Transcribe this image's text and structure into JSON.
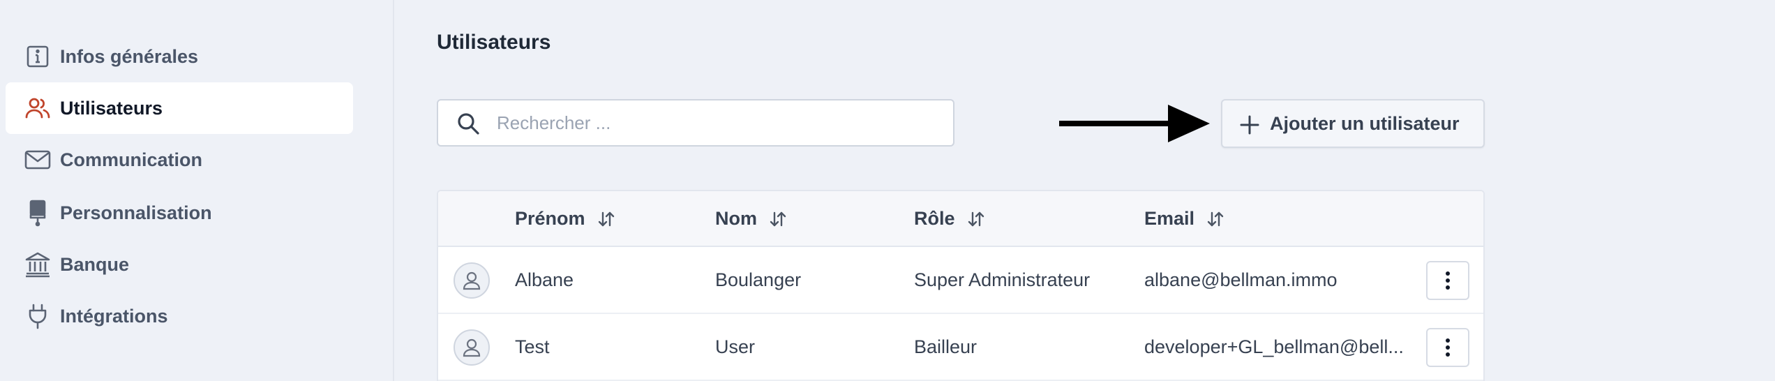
{
  "sidebar": {
    "items": [
      {
        "label": "Infos générales",
        "icon": "info-icon",
        "active": false
      },
      {
        "label": "Utilisateurs",
        "icon": "users-icon",
        "active": true
      },
      {
        "label": "Communication",
        "icon": "mail-icon",
        "active": false
      },
      {
        "label": "Personnalisation",
        "icon": "brush-icon",
        "active": false
      },
      {
        "label": "Banque",
        "icon": "bank-icon",
        "active": false
      },
      {
        "label": "Intégrations",
        "icon": "plug-icon",
        "active": false
      }
    ]
  },
  "main": {
    "title": "Utilisateurs",
    "search": {
      "placeholder": "Rechercher ...",
      "value": ""
    },
    "add_button_label": "Ajouter un utilisateur"
  },
  "table": {
    "columns": [
      "Prénom",
      "Nom",
      "Rôle",
      "Email"
    ],
    "rows": [
      {
        "first_name": "Albane",
        "last_name": "Boulanger",
        "role": "Super Administrateur",
        "email": "albane@bellman.immo"
      },
      {
        "first_name": "Test",
        "last_name": "User",
        "role": "Bailleur",
        "email": "developer+GL_bellman@bell..."
      }
    ]
  },
  "colors": {
    "active_icon": "#c0442b",
    "background": "#eef1f7",
    "arrow": "#000000"
  }
}
